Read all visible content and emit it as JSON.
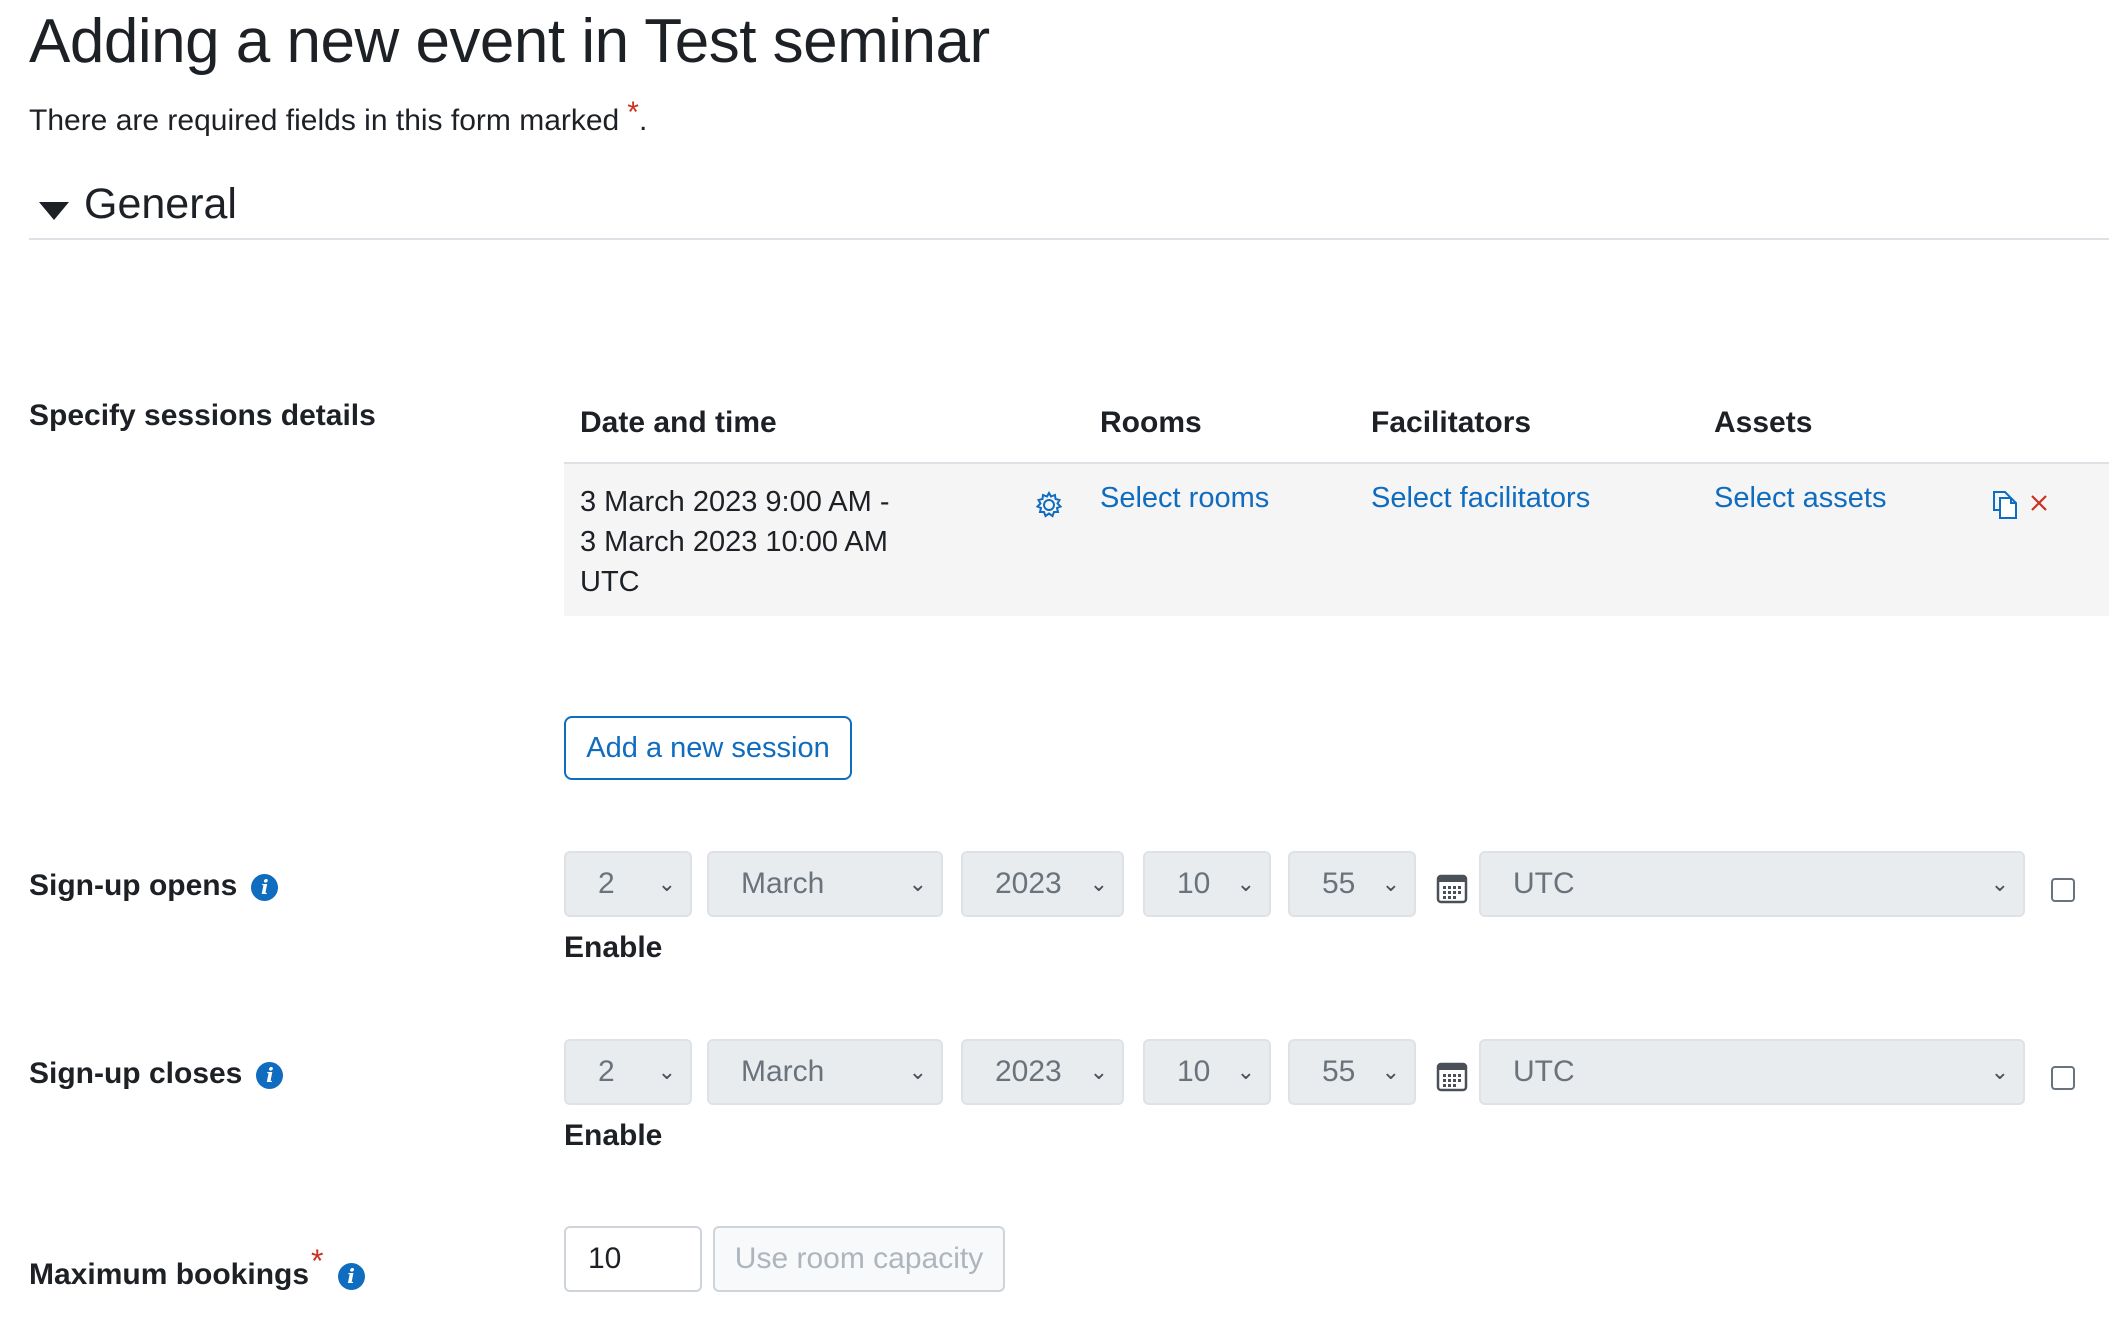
{
  "page": {
    "title": "Adding a new event in Test seminar",
    "required_note": "There are required fields in this form marked",
    "required_marker": "*",
    "required_note_end": "."
  },
  "section": {
    "title": "General",
    "expanded": true
  },
  "sessions": {
    "label": "Specify sessions details",
    "columns": [
      "Date and time",
      "Rooms",
      "Facilitators",
      "Assets"
    ],
    "rows": [
      {
        "datetime": "3 March 2023 9:00 AM -\n3 March 2023 10:00 AM\nUTC",
        "rooms": "Select rooms",
        "facilitators": "Select facilitators",
        "assets": "Select assets"
      }
    ],
    "add_button": "Add a new session"
  },
  "signup_opens": {
    "label": "Sign-up opens",
    "day": "2",
    "month": "March",
    "year": "2023",
    "hour": "10",
    "minute": "55",
    "timezone": "UTC",
    "enable_label": "Enable",
    "enabled": false
  },
  "signup_closes": {
    "label": "Sign-up closes",
    "day": "2",
    "month": "March",
    "year": "2023",
    "hour": "10",
    "minute": "55",
    "timezone": "UTC",
    "enable_label": "Enable",
    "enabled": false
  },
  "max_bookings": {
    "label": "Maximum bookings",
    "required_marker": "*",
    "value": "10",
    "room_capacity_button": "Use room capacity"
  },
  "colors": {
    "link": "#0f6cbf",
    "required": "#ca3120",
    "info": "#0f6cbf"
  },
  "icons": [
    "caret-down-icon",
    "info-icon",
    "gear-icon",
    "copy-icon",
    "close-icon",
    "calendar-icon"
  ]
}
